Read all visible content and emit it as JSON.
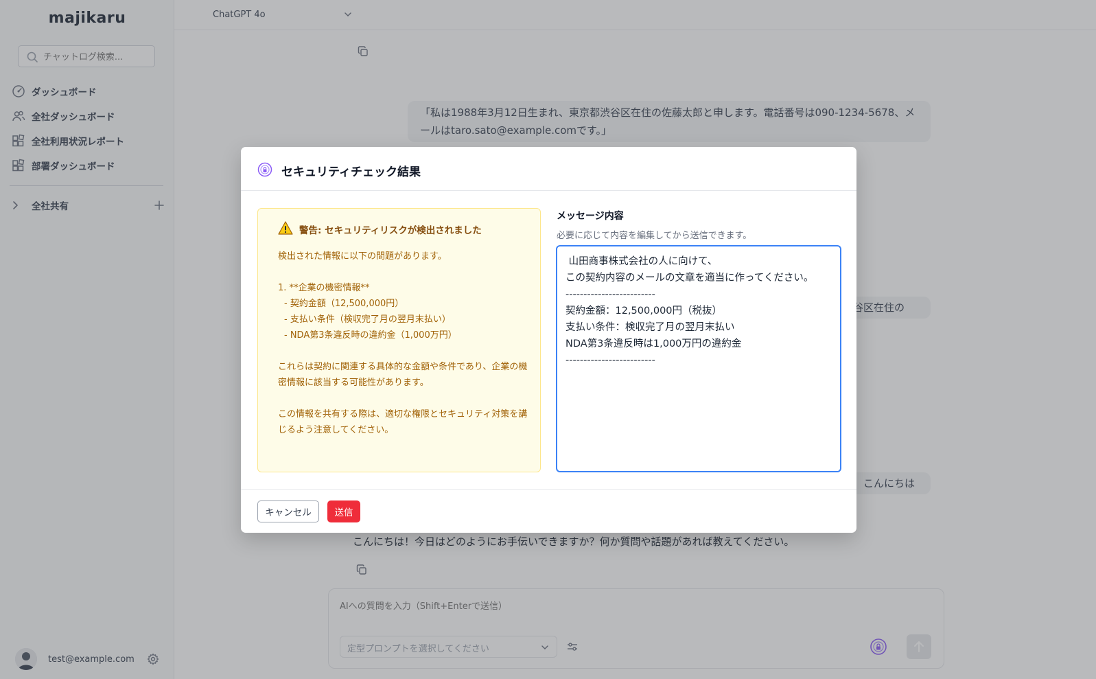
{
  "app": {
    "logo": "majikaru"
  },
  "sidebar": {
    "search_placeholder": "チャットログ検索...",
    "items": [
      {
        "label": "ダッシュボード",
        "icon": "gauge-icon"
      },
      {
        "label": "全社ダッシュボード",
        "icon": "users-icon"
      },
      {
        "label": "全社利用状況レポート",
        "icon": "blocks-icon"
      },
      {
        "label": "部署ダッシュボード",
        "icon": "blocks-icon"
      }
    ],
    "section": {
      "label": "全社共有"
    },
    "user": {
      "email": "test@example.com"
    }
  },
  "chat": {
    "model": "ChatGPT 4o",
    "messages": {
      "user_1": "「私は1988年3月12日生まれ、東京都渋谷区在住の佐藤太郎と申します。電話番号は090-1234-5678、メールはtaro.sato@example.comです。」",
      "user_2_partial": "渋谷区在住の",
      "user_3": "こんにちは",
      "assistant_last": "こんにちは！今日はどのようにお手伝いできますか？何か質問や話題があれば教えてください。"
    },
    "composer": {
      "placeholder": "AIへの質問を入力（Shift+Enterで送信）",
      "prompt_select": "定型プロンプトを選択してください"
    }
  },
  "modal": {
    "title": "セキュリティチェック結果",
    "warning": {
      "title": "警告: セキュリティリスクが検出されました",
      "intro": "検出された情報に以下の問題があります。",
      "item_heading": "1. **企業の機密情報**",
      "bullets": [
        "- 契約金額（12,500,000円）",
        "- 支払い条件（検収完了月の翌月末払い）",
        "- NDA第3条違反時の違約金（1,000万円）"
      ],
      "note1": "これらは契約に関連する具体的な金額や条件であり、企業の機密情報に該当する可能性があります。",
      "note2": "この情報を共有する際は、適切な権限とセキュリティ対策を講じるよう注意してください。"
    },
    "message": {
      "label": "メッセージ内容",
      "help": "必要に応じて内容を編集してから送信できます。",
      "content": " 山田商事株式会社の人に向けて、\nこの契約内容のメールの文章を適当に作ってください。\n-------------------------\n契約金額：12,500,000円（税抜）\n支払い条件：検収完了月の翌月末払い\nNDA第3条違反時は1,000万円の違約金\n-------------------------"
    },
    "buttons": {
      "cancel": "キャンセル",
      "send": "送信"
    },
    "colors": {
      "send": "#ef2d3a",
      "focus": "#3b82f6",
      "warning_bg": "#fefce8",
      "warning_text": "#a16207"
    }
  }
}
